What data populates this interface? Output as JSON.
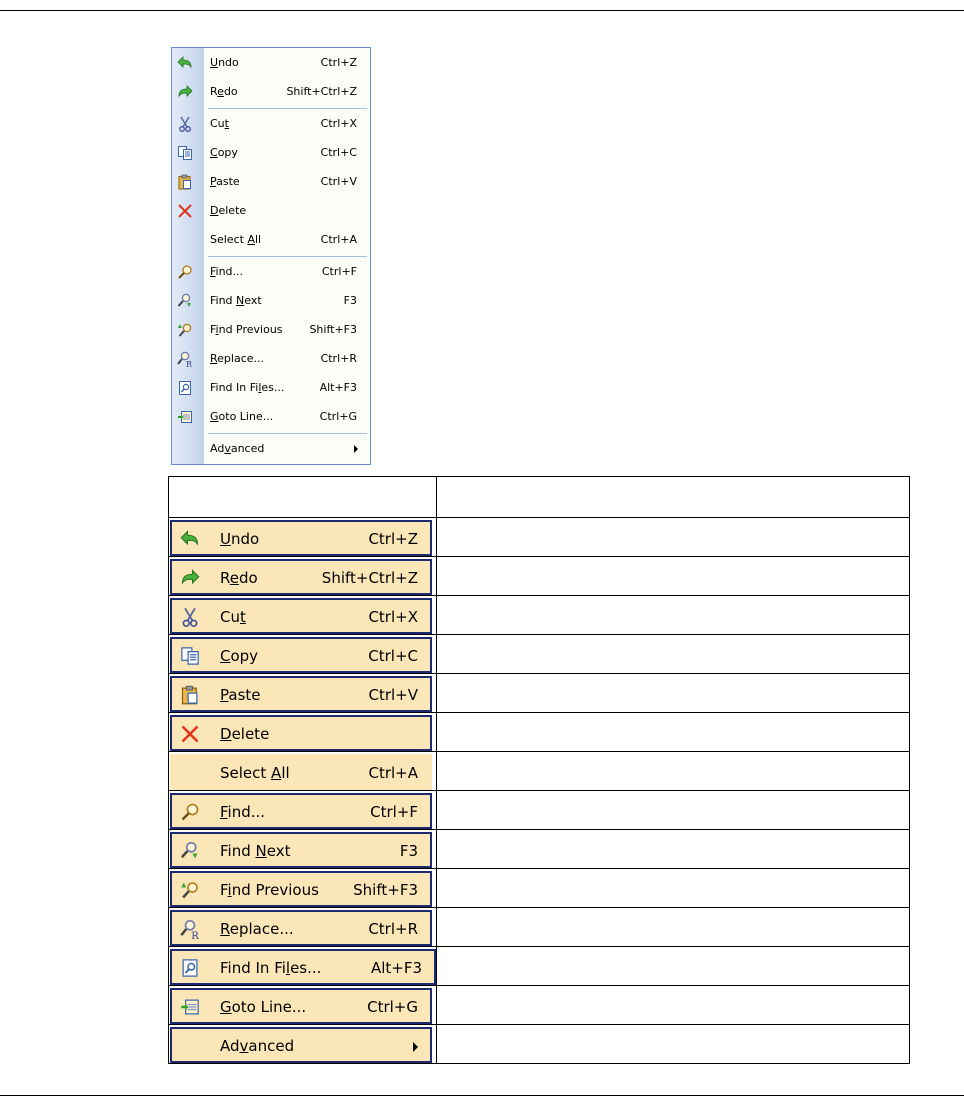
{
  "menu": {
    "items": [
      {
        "pre": "",
        "u": "U",
        "post": "ndo",
        "shortcut": "Ctrl+Z",
        "icon": "undo-icon"
      },
      {
        "pre": "R",
        "u": "e",
        "post": "do",
        "shortcut": "Shift+Ctrl+Z",
        "icon": "redo-icon"
      },
      {
        "pre": "Cu",
        "u": "t",
        "post": "",
        "shortcut": "Ctrl+X",
        "icon": "cut-icon"
      },
      {
        "pre": "",
        "u": "C",
        "post": "opy",
        "shortcut": "Ctrl+C",
        "icon": "copy-icon"
      },
      {
        "pre": "",
        "u": "P",
        "post": "aste",
        "shortcut": "Ctrl+V",
        "icon": "paste-icon"
      },
      {
        "pre": "",
        "u": "D",
        "post": "elete",
        "shortcut": "",
        "icon": "delete-icon"
      },
      {
        "pre": "Select ",
        "u": "A",
        "post": "ll",
        "shortcut": "Ctrl+A",
        "icon": ""
      },
      {
        "pre": "",
        "u": "F",
        "post": "ind...",
        "shortcut": "Ctrl+F",
        "icon": "find-icon"
      },
      {
        "pre": "Find ",
        "u": "N",
        "post": "ext",
        "shortcut": "F3",
        "icon": "find-next-icon"
      },
      {
        "pre": "F",
        "u": "i",
        "post": "nd Previous",
        "shortcut": "Shift+F3",
        "icon": "find-previous-icon"
      },
      {
        "pre": "",
        "u": "R",
        "post": "eplace...",
        "shortcut": "Ctrl+R",
        "icon": "replace-icon"
      },
      {
        "pre": "Find In Fi",
        "u": "l",
        "post": "es...",
        "shortcut": "Alt+F3",
        "icon": "find-in-files-icon"
      },
      {
        "pre": "",
        "u": "G",
        "post": "oto Line...",
        "shortcut": "Ctrl+G",
        "icon": "goto-line-icon"
      },
      {
        "pre": "Ad",
        "u": "v",
        "post": "anced",
        "shortcut": "",
        "icon": "submenu-arrow-icon"
      }
    ]
  },
  "table": {
    "header": [
      "",
      ""
    ],
    "descriptions": [
      "",
      "",
      "",
      "",
      "",
      "",
      "",
      "",
      "",
      "",
      "",
      "",
      "",
      ""
    ]
  },
  "colors": {
    "menu_border": "#6a8ccb",
    "gutter": "#c3d3ec",
    "highlight_bg": "#fbe6b8",
    "highlight_border": "#1d2a6f"
  }
}
